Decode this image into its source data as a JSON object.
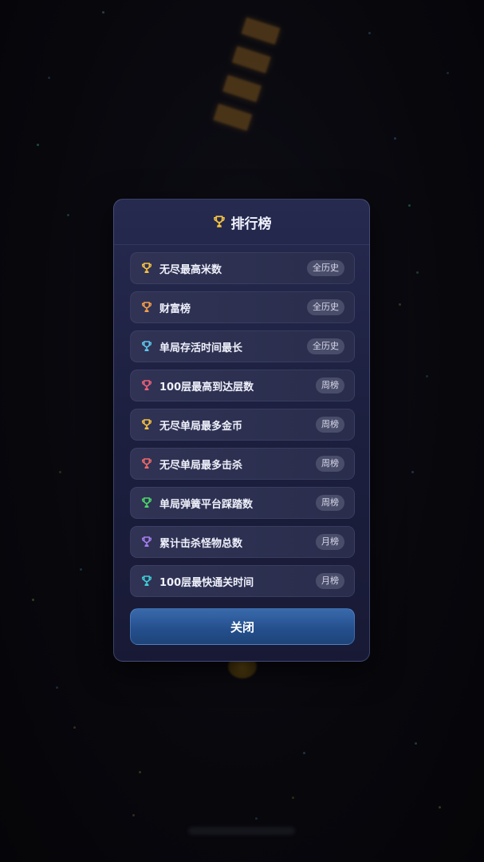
{
  "dialog": {
    "title": "排行榜",
    "title_icon": "trophy-icon",
    "title_icon_color": "#f6c343",
    "close_label": "关闭"
  },
  "leaderboards": [
    {
      "label": "无尽最高米数",
      "badge": "全历史",
      "icon": "trophy-icon",
      "icon_color": "#f6c343"
    },
    {
      "label": "财富榜",
      "badge": "全历史",
      "icon": "trophy-icon",
      "icon_color": "#f5a04a"
    },
    {
      "label": "单局存活时间最长",
      "badge": "全历史",
      "icon": "trophy-icon",
      "icon_color": "#5fc8ec"
    },
    {
      "label": "100层最高到达层数",
      "badge": "周榜",
      "icon": "trophy-icon",
      "icon_color": "#f0607a"
    },
    {
      "label": "无尽单局最多金币",
      "badge": "周榜",
      "icon": "trophy-icon",
      "icon_color": "#f6c343"
    },
    {
      "label": "无尽单局最多击杀",
      "badge": "周榜",
      "icon": "trophy-icon",
      "icon_color": "#f06a6a"
    },
    {
      "label": "单局弹簧平台踩踏数",
      "badge": "周榜",
      "icon": "trophy-icon",
      "icon_color": "#4cd86a"
    },
    {
      "label": "累计击杀怪物总数",
      "badge": "月榜",
      "icon": "trophy-icon",
      "icon_color": "#a77ef0"
    },
    {
      "label": "100层最快通关时间",
      "badge": "月榜",
      "icon": "trophy-icon",
      "icon_color": "#3fd0d8"
    }
  ],
  "colors": {
    "modal_bg": "#22264a",
    "row_bg": "#2e3152",
    "badge_bg": "#4a4d6a",
    "close_button": "#2c5a9c"
  }
}
